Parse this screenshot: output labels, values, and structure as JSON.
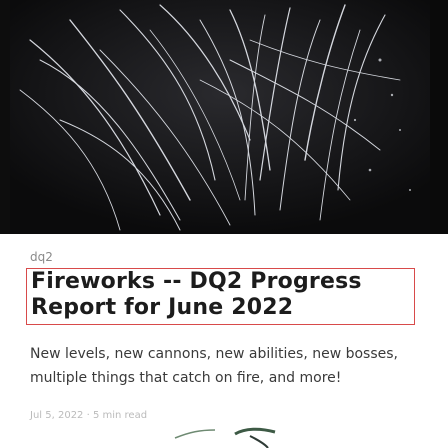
{
  "article": {
    "tag": "dq2",
    "title_line1": "Fireworks -- DQ2 Progress",
    "title_line2": "Report for June 2022",
    "description_line1": "New levels, new cannons, new abilities, new bosses,",
    "description_line2": "multiple things that catch on fire, and more!",
    "meta": "Jul 5, 2022 · 5 min read"
  },
  "hero_image": {
    "subject": "fireworks-sparks"
  },
  "colors": {
    "title_box_border": "#d84a4a",
    "hero_bg": "#111111",
    "spark": "#e9ecf3"
  }
}
